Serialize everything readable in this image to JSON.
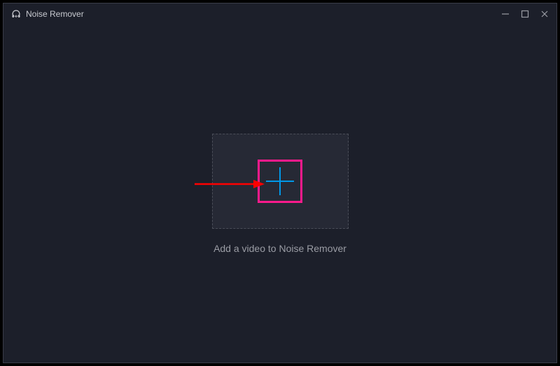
{
  "header": {
    "title": "Noise Remover"
  },
  "main": {
    "instruction": "Add a video to Noise Remover"
  }
}
